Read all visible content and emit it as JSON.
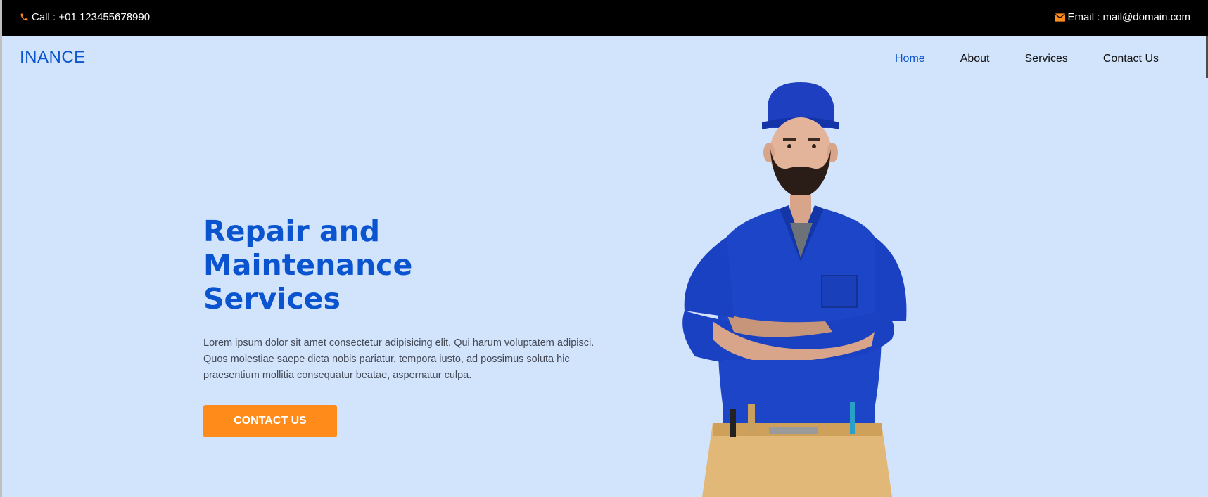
{
  "topbar": {
    "call_text": "Call : +01 123455678990",
    "email_text": "Email : mail@domain.com",
    "call_icon": "phone-icon",
    "email_icon": "envelope-icon"
  },
  "brand": {
    "name": "INANCE"
  },
  "nav": {
    "items": [
      {
        "label": "Home",
        "active": true
      },
      {
        "label": "About",
        "active": false
      },
      {
        "label": "Services",
        "active": false
      },
      {
        "label": "Contact Us",
        "active": false
      }
    ]
  },
  "hero": {
    "title_lines": [
      "Repair and",
      "Maintenance",
      "Services"
    ],
    "description": "Lorem ipsum dolor sit amet consectetur adipisicing elit. Qui harum voluptatem adipisci. Quos molestiae saepe dicta nobis pariatur, tempora iusto, ad possimus soluta hic praesentium mollitia consequatur beatae, aspernatur culpa.",
    "cta_label": "CONTACT US"
  },
  "colors": {
    "accent_blue": "#0b54d0",
    "accent_orange": "#ff8c1a",
    "background": "#d2e3fc",
    "topbar": "#000000"
  }
}
